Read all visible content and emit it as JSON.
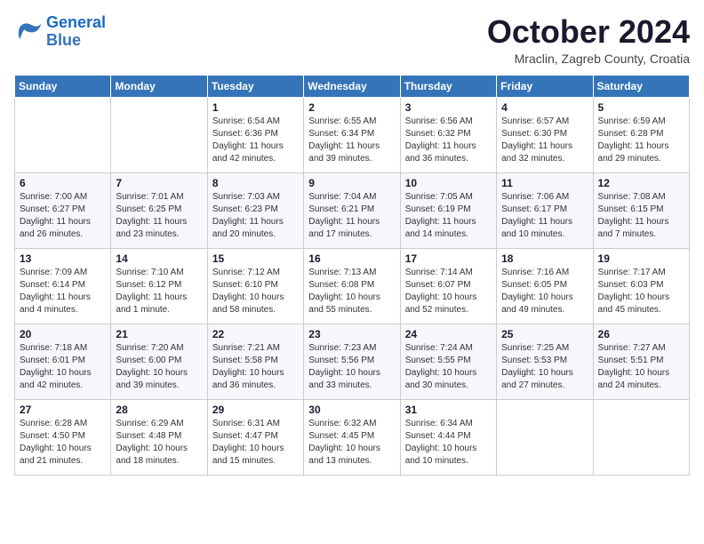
{
  "logo": {
    "line1": "General",
    "line2": "Blue"
  },
  "title": "October 2024",
  "location": "Mraclin, Zagreb County, Croatia",
  "weekdays": [
    "Sunday",
    "Monday",
    "Tuesday",
    "Wednesday",
    "Thursday",
    "Friday",
    "Saturday"
  ],
  "weeks": [
    [
      {
        "day": null,
        "info": null
      },
      {
        "day": null,
        "info": null
      },
      {
        "day": "1",
        "info": "Sunrise: 6:54 AM\nSunset: 6:36 PM\nDaylight: 11 hours and 42 minutes."
      },
      {
        "day": "2",
        "info": "Sunrise: 6:55 AM\nSunset: 6:34 PM\nDaylight: 11 hours and 39 minutes."
      },
      {
        "day": "3",
        "info": "Sunrise: 6:56 AM\nSunset: 6:32 PM\nDaylight: 11 hours and 36 minutes."
      },
      {
        "day": "4",
        "info": "Sunrise: 6:57 AM\nSunset: 6:30 PM\nDaylight: 11 hours and 32 minutes."
      },
      {
        "day": "5",
        "info": "Sunrise: 6:59 AM\nSunset: 6:28 PM\nDaylight: 11 hours and 29 minutes."
      }
    ],
    [
      {
        "day": "6",
        "info": "Sunrise: 7:00 AM\nSunset: 6:27 PM\nDaylight: 11 hours and 26 minutes."
      },
      {
        "day": "7",
        "info": "Sunrise: 7:01 AM\nSunset: 6:25 PM\nDaylight: 11 hours and 23 minutes."
      },
      {
        "day": "8",
        "info": "Sunrise: 7:03 AM\nSunset: 6:23 PM\nDaylight: 11 hours and 20 minutes."
      },
      {
        "day": "9",
        "info": "Sunrise: 7:04 AM\nSunset: 6:21 PM\nDaylight: 11 hours and 17 minutes."
      },
      {
        "day": "10",
        "info": "Sunrise: 7:05 AM\nSunset: 6:19 PM\nDaylight: 11 hours and 14 minutes."
      },
      {
        "day": "11",
        "info": "Sunrise: 7:06 AM\nSunset: 6:17 PM\nDaylight: 11 hours and 10 minutes."
      },
      {
        "day": "12",
        "info": "Sunrise: 7:08 AM\nSunset: 6:15 PM\nDaylight: 11 hours and 7 minutes."
      }
    ],
    [
      {
        "day": "13",
        "info": "Sunrise: 7:09 AM\nSunset: 6:14 PM\nDaylight: 11 hours and 4 minutes."
      },
      {
        "day": "14",
        "info": "Sunrise: 7:10 AM\nSunset: 6:12 PM\nDaylight: 11 hours and 1 minute."
      },
      {
        "day": "15",
        "info": "Sunrise: 7:12 AM\nSunset: 6:10 PM\nDaylight: 10 hours and 58 minutes."
      },
      {
        "day": "16",
        "info": "Sunrise: 7:13 AM\nSunset: 6:08 PM\nDaylight: 10 hours and 55 minutes."
      },
      {
        "day": "17",
        "info": "Sunrise: 7:14 AM\nSunset: 6:07 PM\nDaylight: 10 hours and 52 minutes."
      },
      {
        "day": "18",
        "info": "Sunrise: 7:16 AM\nSunset: 6:05 PM\nDaylight: 10 hours and 49 minutes."
      },
      {
        "day": "19",
        "info": "Sunrise: 7:17 AM\nSunset: 6:03 PM\nDaylight: 10 hours and 45 minutes."
      }
    ],
    [
      {
        "day": "20",
        "info": "Sunrise: 7:18 AM\nSunset: 6:01 PM\nDaylight: 10 hours and 42 minutes."
      },
      {
        "day": "21",
        "info": "Sunrise: 7:20 AM\nSunset: 6:00 PM\nDaylight: 10 hours and 39 minutes."
      },
      {
        "day": "22",
        "info": "Sunrise: 7:21 AM\nSunset: 5:58 PM\nDaylight: 10 hours and 36 minutes."
      },
      {
        "day": "23",
        "info": "Sunrise: 7:23 AM\nSunset: 5:56 PM\nDaylight: 10 hours and 33 minutes."
      },
      {
        "day": "24",
        "info": "Sunrise: 7:24 AM\nSunset: 5:55 PM\nDaylight: 10 hours and 30 minutes."
      },
      {
        "day": "25",
        "info": "Sunrise: 7:25 AM\nSunset: 5:53 PM\nDaylight: 10 hours and 27 minutes."
      },
      {
        "day": "26",
        "info": "Sunrise: 7:27 AM\nSunset: 5:51 PM\nDaylight: 10 hours and 24 minutes."
      }
    ],
    [
      {
        "day": "27",
        "info": "Sunrise: 6:28 AM\nSunset: 4:50 PM\nDaylight: 10 hours and 21 minutes."
      },
      {
        "day": "28",
        "info": "Sunrise: 6:29 AM\nSunset: 4:48 PM\nDaylight: 10 hours and 18 minutes."
      },
      {
        "day": "29",
        "info": "Sunrise: 6:31 AM\nSunset: 4:47 PM\nDaylight: 10 hours and 15 minutes."
      },
      {
        "day": "30",
        "info": "Sunrise: 6:32 AM\nSunset: 4:45 PM\nDaylight: 10 hours and 13 minutes."
      },
      {
        "day": "31",
        "info": "Sunrise: 6:34 AM\nSunset: 4:44 PM\nDaylight: 10 hours and 10 minutes."
      },
      {
        "day": null,
        "info": null
      },
      {
        "day": null,
        "info": null
      }
    ]
  ]
}
